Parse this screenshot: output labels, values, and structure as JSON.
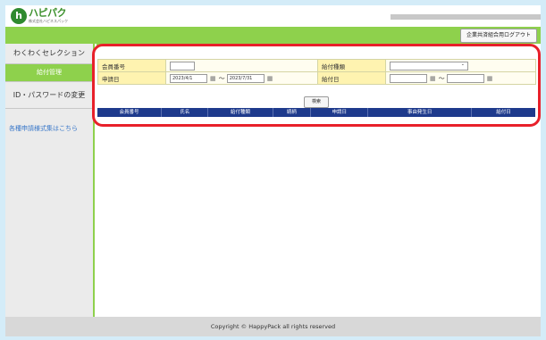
{
  "header": {
    "logo_mark": "h",
    "logo_text": "ハピパク",
    "logo_subtext": "株式会社ハピネスパック"
  },
  "topbar": {
    "logout_label": "企業共済組合用ログアウト"
  },
  "sidebar": {
    "items": [
      {
        "label": "わくわくセレクション"
      },
      {
        "label": "給付管理"
      },
      {
        "label": "ID・パスワードの変更"
      }
    ],
    "link_label": "各種申請様式集はこちら"
  },
  "form": {
    "member_no_label": "会員番号",
    "member_no_value": "",
    "benefit_type_label": "給付種類",
    "benefit_type_value": "",
    "apply_date_label": "申請日",
    "apply_date_from": "2023/4/1",
    "apply_date_to": "2023/7/31",
    "benefit_date_label": "給付日",
    "benefit_date_from": "",
    "benefit_date_to": "",
    "range_sep": "～",
    "calendar_glyph": "▦",
    "search_label": "検索"
  },
  "results": {
    "columns": [
      "会員番号",
      "氏名",
      "給付種類",
      "続柄",
      "申請日",
      "事由発生日",
      "給付日"
    ]
  },
  "footer": {
    "copyright": "Copyright © HappyPack all rights reserved"
  }
}
